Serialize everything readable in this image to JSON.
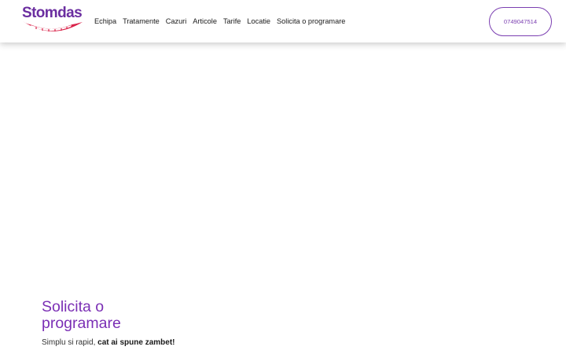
{
  "brand": {
    "name": "Stomdas",
    "primary_color": "#7b3fb1",
    "accent_color": "#d9234a"
  },
  "nav": {
    "items": [
      {
        "id": "echipa",
        "label": "Echipa"
      },
      {
        "id": "tratamente",
        "label": "Tratamente"
      },
      {
        "id": "cazuri",
        "label": "Cazuri"
      },
      {
        "id": "articole",
        "label": "Articole"
      },
      {
        "id": "tarife",
        "label": "Tarife"
      },
      {
        "id": "locatie",
        "label": "Locatie"
      },
      {
        "id": "programare",
        "label": "Solicita o programare"
      }
    ]
  },
  "header": {
    "phone": "0749047514"
  },
  "hero": {
    "title": "Solicita o programare",
    "subtitle_plain": "Simplu si rapid, ",
    "subtitle_bold": "cat ai spune zambet!"
  }
}
